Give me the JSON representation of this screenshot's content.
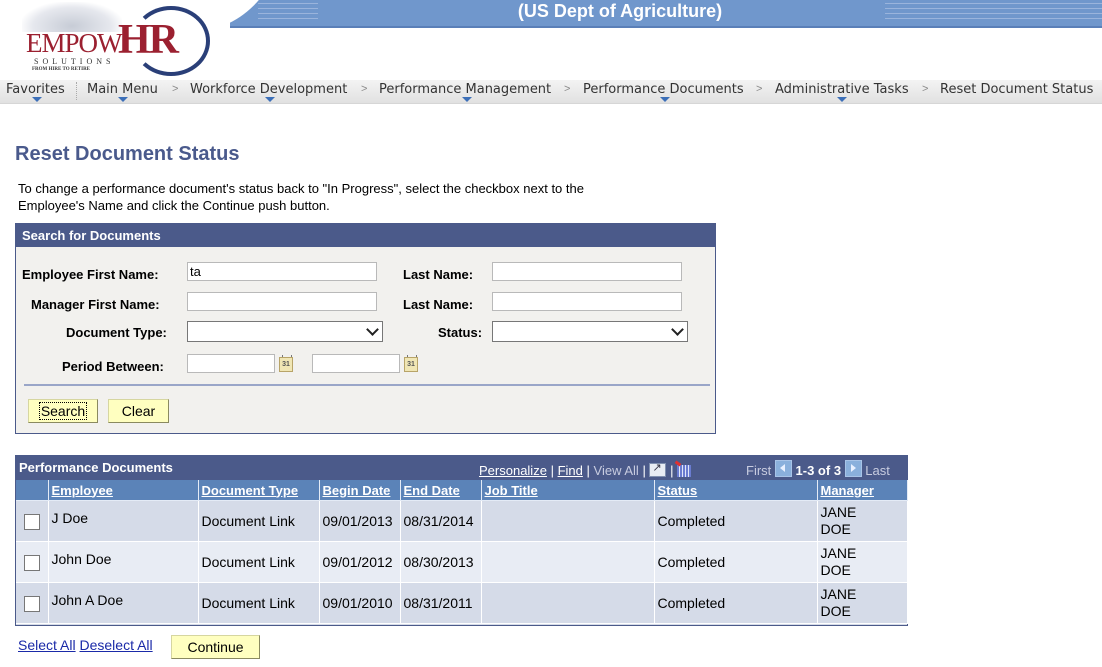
{
  "banner": {
    "title": "(US Dept of Agriculture)"
  },
  "logo": {
    "name_part1": "EMPOW",
    "name_part2": "HR",
    "solutions": "SOLUTIONS",
    "tagline": "FROM HIRE TO RETIRE"
  },
  "nav": {
    "items": [
      {
        "label": "Favorites",
        "has_menu": true
      },
      {
        "label": "Main Menu",
        "has_menu": true
      },
      {
        "label": "Workforce Development",
        "has_menu": true
      },
      {
        "label": "Performance Management",
        "has_menu": true
      },
      {
        "label": "Performance Documents",
        "has_menu": true
      },
      {
        "label": "Administrative Tasks",
        "has_menu": true
      },
      {
        "label": "Reset Document Status",
        "has_menu": false
      }
    ],
    "separator": ">"
  },
  "page": {
    "title": "Reset Document Status",
    "instructions_line1": "To change a performance document's status back to \"In Progress\", select the checkbox next to the",
    "instructions_line2": "Employee's Name and click the Continue push button."
  },
  "search": {
    "header": "Search for Documents",
    "employee_first_name_label": "Employee First Name:",
    "employee_first_name_value": "ta",
    "employee_last_name_label": "Last Name:",
    "employee_last_name_value": "",
    "manager_first_name_label": "Manager First Name:",
    "manager_first_name_value": "",
    "manager_last_name_label": "Last Name:",
    "manager_last_name_value": "",
    "document_type_label": "Document Type:",
    "document_type_value": "",
    "status_label": "Status:",
    "status_value": "",
    "period_between_label": "Period Between:",
    "period_from_value": "",
    "period_to_value": "",
    "calendar_icon_text": "31",
    "search_button": "Search",
    "clear_button": "Clear"
  },
  "grid": {
    "title": "Performance Documents",
    "personalize": "Personalize",
    "find": "Find",
    "view_all": "View All",
    "pipe": "|",
    "first": "First",
    "range": "1-3 of 3",
    "last": "Last",
    "columns": [
      "",
      "Employee",
      "Document Type",
      "Begin Date",
      "End Date",
      "Job Title",
      "Status",
      "Manager"
    ],
    "rows": [
      {
        "checked": false,
        "employee": "J Doe",
        "document_type": "Document Link",
        "begin_date": "09/01/2013",
        "end_date": "08/31/2014",
        "job_title": "",
        "status": "Completed",
        "manager_line1": "JANE",
        "manager_line2": "DOE"
      },
      {
        "checked": false,
        "employee": "John Doe",
        "document_type": "Document Link",
        "begin_date": "09/01/2012",
        "end_date": "08/30/2013",
        "job_title": "",
        "status": "Completed",
        "manager_line1": "JANE",
        "manager_line2": "DOE"
      },
      {
        "checked": false,
        "employee": "John A Doe",
        "document_type": "Document Link",
        "begin_date": "09/01/2010",
        "end_date": "08/31/2011",
        "job_title": "",
        "status": "Completed",
        "manager_line1": "JANE",
        "manager_line2": "DOE"
      }
    ]
  },
  "footer": {
    "select_all": "Select All",
    "deselect_all": "Deselect All",
    "continue_button": "Continue"
  },
  "colors": {
    "banner_blue": "#7097cc",
    "header_navy": "#4b5a8a",
    "column_header_blue": "#5b83b8",
    "title_color": "#4a5a8c",
    "button_yellow": "#ffffc0",
    "row_odd": "#d5dbe8",
    "row_even": "#e8ecf4"
  }
}
